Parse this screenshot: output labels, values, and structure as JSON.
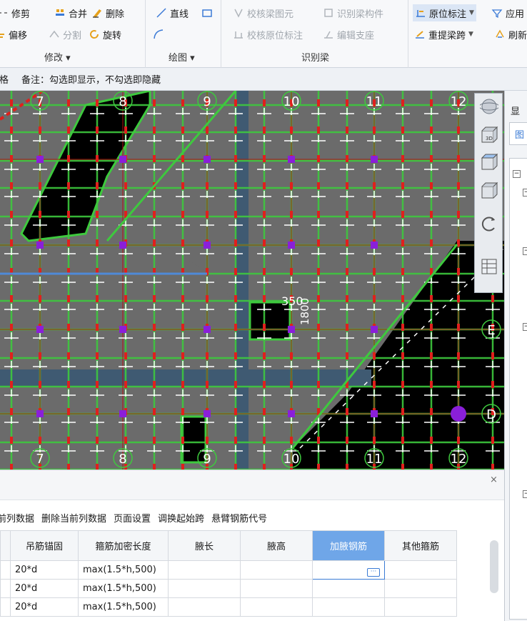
{
  "ribbon": {
    "modify": {
      "trim": "修剪",
      "merge": "合并",
      "delete": "删除",
      "offset": "偏移",
      "split": "分割",
      "rotate": "旋转",
      "label": "修改 ▾"
    },
    "draw": {
      "line": "直线",
      "label": "绘图 ▾"
    },
    "identify_beam": {
      "check_beam": "校核梁图元",
      "identify_member": "识别梁构件",
      "check_origin": "校核原位标注",
      "edit_support": "编辑支座",
      "label": "识别梁"
    },
    "right": {
      "origin_label": "原位标注",
      "apply": "应用",
      "reextract": "重提梁跨",
      "refresh": "刷新"
    }
  },
  "notebar": {
    "left": "表格",
    "note": "备注：勾选即显示，不勾选即隐藏"
  },
  "canvas": {
    "axis_top": [
      "7",
      "8",
      "9",
      "10",
      "11",
      "12"
    ],
    "axis_bottom": [
      "7",
      "8",
      "9",
      "10",
      "11",
      "12"
    ],
    "axis_right": [
      "E",
      "D"
    ],
    "dim_text_1": "350",
    "dim_text_2": "1800"
  },
  "colors": {
    "canvas_bg": "#000000",
    "slab": "#6b6b6b",
    "beam_green": "#3ec93e",
    "rebar_red": "#e0201c",
    "column_purple": "#8a1fd9",
    "strip_blue": "#3f5a72",
    "selected_header": "#6fa6e8"
  },
  "bottom": {
    "close": "×",
    "links": [
      "前列数据",
      "删除当前列数据",
      "页面设置",
      "调换起始跨",
      "悬臂钢筋代号"
    ],
    "headers": [
      "吊筋锚固",
      "箍筋加密长度",
      "腋长",
      "腋高",
      "加腋钢筋",
      "其他箍筋"
    ],
    "rows": [
      [
        "20*d",
        "max(1.5*h,500)",
        "",
        "",
        "",
        ""
      ],
      [
        "20*d",
        "max(1.5*h,500)",
        "",
        "",
        "",
        ""
      ],
      [
        "20*d",
        "max(1.5*h,500)",
        "",
        "",
        "",
        ""
      ]
    ],
    "edit_glyph": "···"
  },
  "rpanel": {
    "top_char": "显",
    "tab_char": "图"
  }
}
